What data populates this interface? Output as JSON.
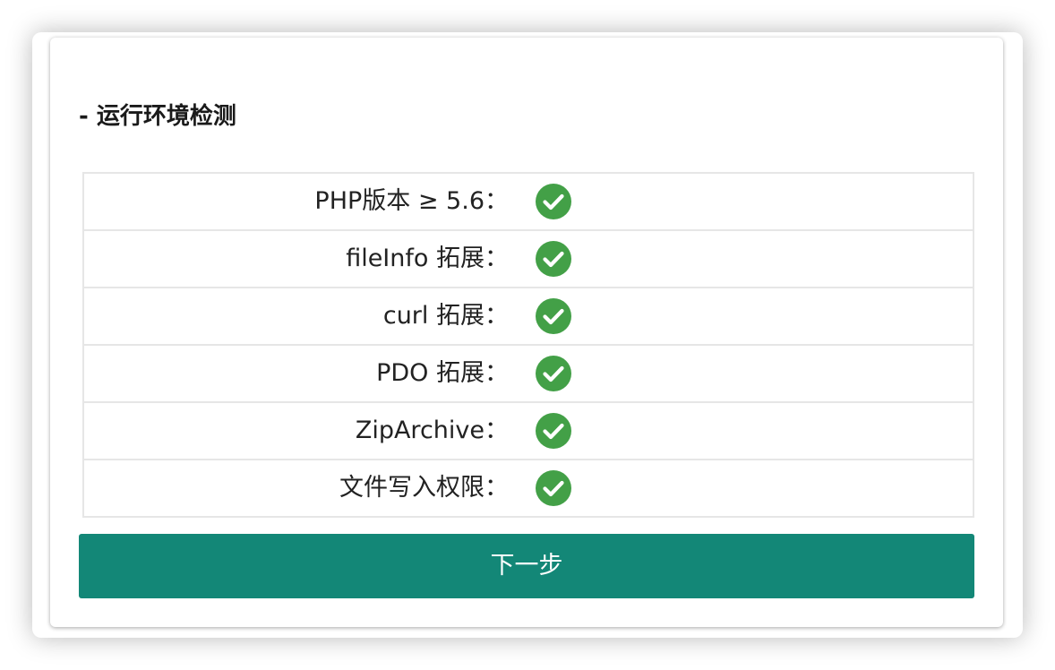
{
  "section": {
    "title": "- 运行环境检测"
  },
  "checks": [
    {
      "label": "PHP版本 ≥ 5.6：",
      "status": "passed",
      "icon": "check-circle-icon"
    },
    {
      "label": "fileInfo 拓展：",
      "status": "passed",
      "icon": "check-circle-icon"
    },
    {
      "label": "curl 拓展：",
      "status": "passed",
      "icon": "check-circle-icon"
    },
    {
      "label": "PDO 拓展：",
      "status": "passed",
      "icon": "check-circle-icon"
    },
    {
      "label": "ZipArchive：",
      "status": "passed",
      "icon": "check-circle-icon"
    },
    {
      "label": "文件写入权限：",
      "status": "passed",
      "icon": "check-circle-icon"
    }
  ],
  "actions": {
    "next_label": "下一步"
  },
  "colors": {
    "success": "#43a047",
    "primary_button": "#138777",
    "border": "#e6e6e6"
  }
}
